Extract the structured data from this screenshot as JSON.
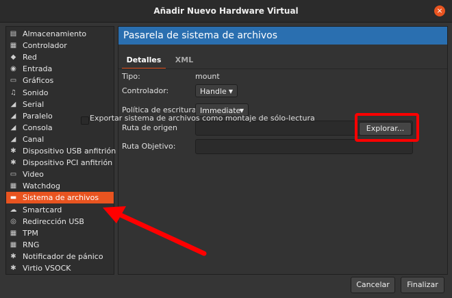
{
  "window": {
    "title": "Añadir Nuevo Hardware Virtual",
    "close_icon": "×"
  },
  "sidebar": {
    "items": [
      {
        "label": "Almacenamiento",
        "icon": "storage-icon",
        "glyph": "▤"
      },
      {
        "label": "Controlador",
        "icon": "controller-icon",
        "glyph": "▦"
      },
      {
        "label": "Red",
        "icon": "network-icon",
        "glyph": "◆"
      },
      {
        "label": "Entrada",
        "icon": "mouse-icon",
        "glyph": "◉"
      },
      {
        "label": "Gráficos",
        "icon": "display-icon",
        "glyph": "▭"
      },
      {
        "label": "Sonido",
        "icon": "sound-icon",
        "glyph": "♫"
      },
      {
        "label": "Serial",
        "icon": "serial-icon",
        "glyph": "◢"
      },
      {
        "label": "Paralelo",
        "icon": "parallel-icon",
        "glyph": "◢"
      },
      {
        "label": "Consola",
        "icon": "console-icon",
        "glyph": "◢"
      },
      {
        "label": "Canal",
        "icon": "channel-icon",
        "glyph": "◢"
      },
      {
        "label": "Dispositivo USB anfitrión",
        "icon": "usb-icon",
        "glyph": "✱"
      },
      {
        "label": "Dispositivo PCI anfitrión",
        "icon": "pci-icon",
        "glyph": "✱"
      },
      {
        "label": "Video",
        "icon": "video-icon",
        "glyph": "▭"
      },
      {
        "label": "Watchdog",
        "icon": "watchdog-icon",
        "glyph": "▦"
      },
      {
        "label": "Sistema de archivos",
        "icon": "folder-icon",
        "glyph": "▬"
      },
      {
        "label": "Smartcard",
        "icon": "smartcard-icon",
        "glyph": "☁"
      },
      {
        "label": "Redirección USB",
        "icon": "usb-redirect-icon",
        "glyph": "◎"
      },
      {
        "label": "TPM",
        "icon": "tpm-icon",
        "glyph": "▦"
      },
      {
        "label": "RNG",
        "icon": "rng-icon",
        "glyph": "▦"
      },
      {
        "label": "Notificador de pánico",
        "icon": "panic-icon",
        "glyph": "✱"
      },
      {
        "label": "Virtio VSOCK",
        "icon": "vsock-icon",
        "glyph": "✱"
      }
    ],
    "selected": "Sistema de archivos"
  },
  "panel": {
    "header": "Pasarela de sistema de archivos",
    "tabs": [
      {
        "label": "Detalles",
        "active": true
      },
      {
        "label": "XML",
        "active": false
      }
    ],
    "fields": {
      "tipo_label": "Tipo:",
      "tipo_value": "mount",
      "controlador_label": "Controlador:",
      "controlador_value": "Handle",
      "politica_label": "Política de escritura:",
      "politica_value": "Immediate",
      "ruta_origen_label": "Ruta de origen",
      "ruta_origen_value": "",
      "explorar_label": "Explorar...",
      "ruta_objetivo_label": "Ruta Objetivo:",
      "ruta_objetivo_value": "",
      "readonly_label": "Exportar sistema de archivos como montaje de sólo-lectura",
      "readonly_checked": false
    }
  },
  "footer": {
    "cancel": "Cancelar",
    "finish": "Finalizar"
  },
  "colors": {
    "accent": "#e95420",
    "header": "#2a6fb0",
    "annotation": "#ff0000"
  }
}
